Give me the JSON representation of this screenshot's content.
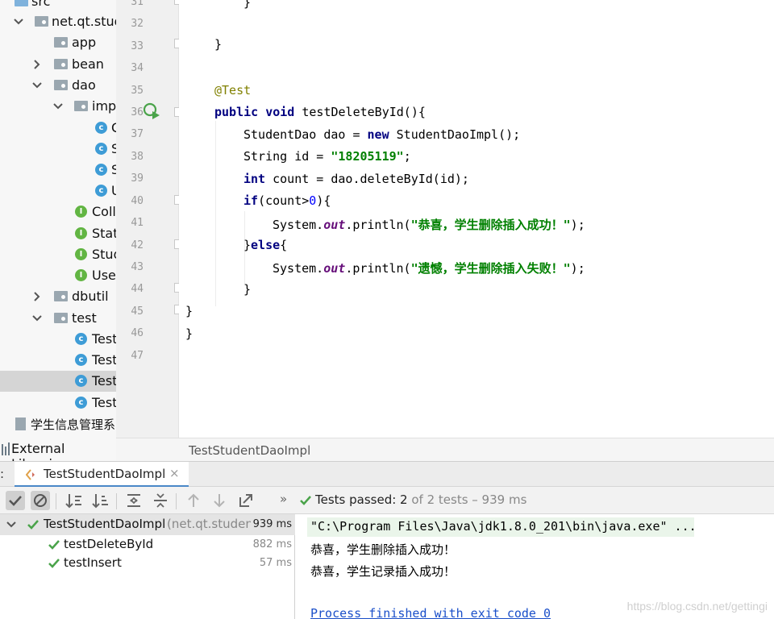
{
  "tree": {
    "items": [
      {
        "label": "src",
        "kind": "src-folder"
      },
      {
        "label": "net.qt.stud",
        "kind": "package"
      },
      {
        "label": "app",
        "kind": "package"
      },
      {
        "label": "bean",
        "kind": "package"
      },
      {
        "label": "dao",
        "kind": "package"
      },
      {
        "label": "imp",
        "kind": "package"
      },
      {
        "label": "C",
        "kind": "class"
      },
      {
        "label": "S",
        "kind": "class"
      },
      {
        "label": "S",
        "kind": "class"
      },
      {
        "label": "U",
        "kind": "class"
      },
      {
        "label": "Coll",
        "kind": "interface"
      },
      {
        "label": "Stat",
        "kind": "interface"
      },
      {
        "label": "Stud",
        "kind": "interface"
      },
      {
        "label": "Use",
        "kind": "interface"
      },
      {
        "label": "dbutil",
        "kind": "package"
      },
      {
        "label": "test",
        "kind": "package"
      },
      {
        "label": "Test",
        "kind": "test-class"
      },
      {
        "label": "Test",
        "kind": "test-class"
      },
      {
        "label": "Test",
        "kind": "test-class"
      },
      {
        "label": "Test",
        "kind": "class"
      },
      {
        "label": "学生信息管理系",
        "kind": "module-file"
      },
      {
        "label": "External Libraries",
        "kind": "libraries"
      }
    ]
  },
  "editor": {
    "line_numbers": [
      "31",
      "32",
      "33",
      "34",
      "35",
      "36",
      "37",
      "38",
      "39",
      "40",
      "41",
      "42",
      "43",
      "44",
      "45",
      "46",
      "47"
    ],
    "code": {
      "l31": "}",
      "l33": "}",
      "l35_annotation": "@Test",
      "l36_kw1": "public",
      "l36_kw2": "void",
      "l36_rest": " testDeleteById(){",
      "l37_a": "StudentDao dao = ",
      "l37_kw": "new",
      "l37_b": " StudentDaoImpl();",
      "l38_a": "String id = ",
      "l38_str": "\"18205119\"",
      "l38_b": ";",
      "l39_kw": "int",
      "l39_b": " count = dao.deleteById(id);",
      "l40_kw": "if",
      "l40_a": "(count>",
      "l40_num": "0",
      "l40_b": "){",
      "l41_a": "System.",
      "l41_fld": "out",
      "l41_b": ".println(",
      "l41_str": "\"恭喜，学生删除插入成功！\"",
      "l41_c": ");",
      "l42_a": "}",
      "l42_kw": "else",
      "l42_b": "{",
      "l43_a": "System.",
      "l43_fld": "out",
      "l43_b": ".println(",
      "l43_str": "\"遗憾，学生删除插入失败！\"",
      "l43_c": ");",
      "l44": "}",
      "l45": "}",
      "l46": "}"
    },
    "breadcrumb": "TestStudentDaoImpl"
  },
  "run": {
    "prefix": ":",
    "tab_label": "TestStudentDaoImpl",
    "status_prefix": "Tests passed: ",
    "status_count": "2",
    "status_suffix": " of 2 tests – 939 ms",
    "more_glyph": "»",
    "results": [
      {
        "name": "TestStudentDaoImpl",
        "detail": "(net.qt.studen",
        "time": "939 ms"
      },
      {
        "name": "testDeleteById",
        "time": "882 ms"
      },
      {
        "name": "testInsert",
        "time": "57 ms"
      }
    ],
    "console": {
      "cmd": "\"C:\\Program Files\\Java\\jdk1.8.0_201\\bin\\java.exe\" ...",
      "out1": "恭喜，学生删除插入成功！",
      "out2": "恭喜，学生记录插入成功！",
      "exit": "Process finished with exit code 0"
    }
  },
  "watermark": "https://blog.csdn.net/gettingi",
  "colors": {
    "keyword": "#000080",
    "string": "#008000",
    "annotation": "#808000",
    "pass_green": "#4aa34a",
    "selection": "#d5d5d5",
    "current_line": "#fdfbe7"
  }
}
